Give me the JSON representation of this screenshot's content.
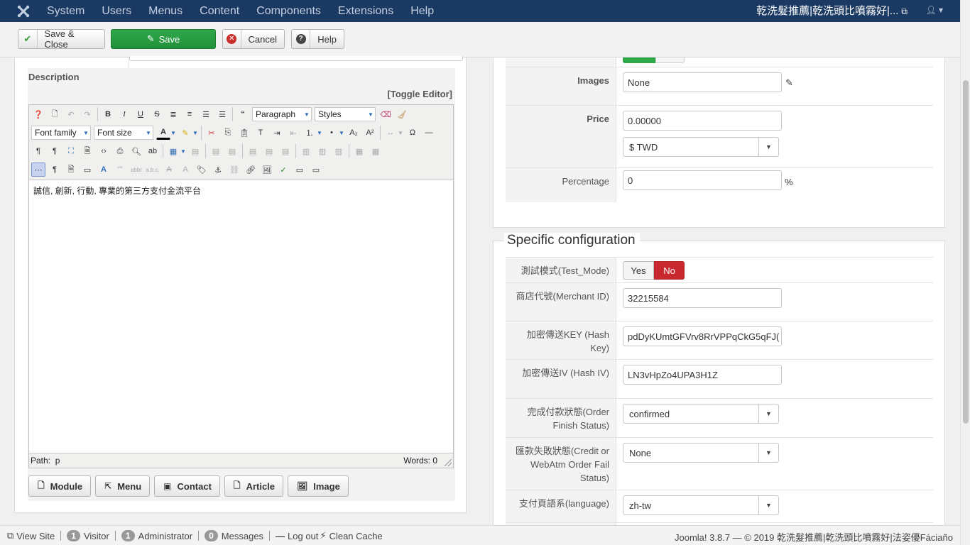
{
  "navbar": {
    "menu": [
      "System",
      "Users",
      "Menus",
      "Content",
      "Components",
      "Extensions",
      "Help"
    ],
    "site_name": "乾洗髮推薦|乾洗頭比噴霧好|..."
  },
  "toolbar": {
    "save_close": "Save & Close",
    "save": "Save",
    "cancel": "Cancel",
    "help": "Help"
  },
  "description": {
    "label": "Description",
    "toggle": "[Toggle Editor]",
    "content": "誠信, 創新, 行動, 專業的第三方支付金流平台",
    "path_label": "Path:",
    "path_value": "p",
    "words": "Words: 0"
  },
  "editor": {
    "format_select": "Paragraph",
    "styles_select": "Styles",
    "font_family": "Font family",
    "font_size": "Font size"
  },
  "insert_buttons": [
    "Module",
    "Menu",
    "Contact",
    "Article",
    "Image"
  ],
  "pricing": {
    "images_label": "Images",
    "images_value": "None",
    "price_label": "Price",
    "price_value": "0.00000",
    "currency_value": "$ TWD",
    "percentage_label": "Percentage",
    "percentage_value": "0",
    "percent_sign": "%"
  },
  "specific": {
    "legend": "Specific configuration",
    "test_mode_label": "測試模式(Test_Mode)",
    "test_yes": "Yes",
    "test_no": "No",
    "merchant_label": "商店代號(Merchant ID)",
    "merchant_value": "32215584",
    "hashkey_label": "加密傳送KEY (Hash Key)",
    "hashkey_value": "pdDyKUmtGFVrv8RrVPPqCkG5qFJ(",
    "hashiv_label": "加密傳送IV (Hash IV)",
    "hashiv_value": "LN3vHpZo4UPA3H1Z",
    "finish_label": "完成付款狀態(Order Finish Status)",
    "finish_value": "confirmed",
    "fail_label": "匯款失敗狀態(Credit or WebAtm Order Fail Status)",
    "fail_value": "None",
    "lang_label": "支付頁語系(language)",
    "lang_value": "zh-tw"
  },
  "status": {
    "view_site": "View Site",
    "visitors_count": "1",
    "visitors_label": "Visitor",
    "admins_count": "1",
    "admins_label": "Administrator",
    "messages_count": "0",
    "messages_label": "Messages",
    "logout": "Log out",
    "clean_cache": "Clean Cache",
    "footer": "Joomla! 3.8.7 — © 2019 乾洗髮推薦|乾洗頭比噴霧好|法姿優Fáciaño"
  },
  "colors": {
    "navbar_bg": "#1b3a63",
    "save_green": "#2fa84a",
    "toggle_no_red": "#c8282e"
  }
}
